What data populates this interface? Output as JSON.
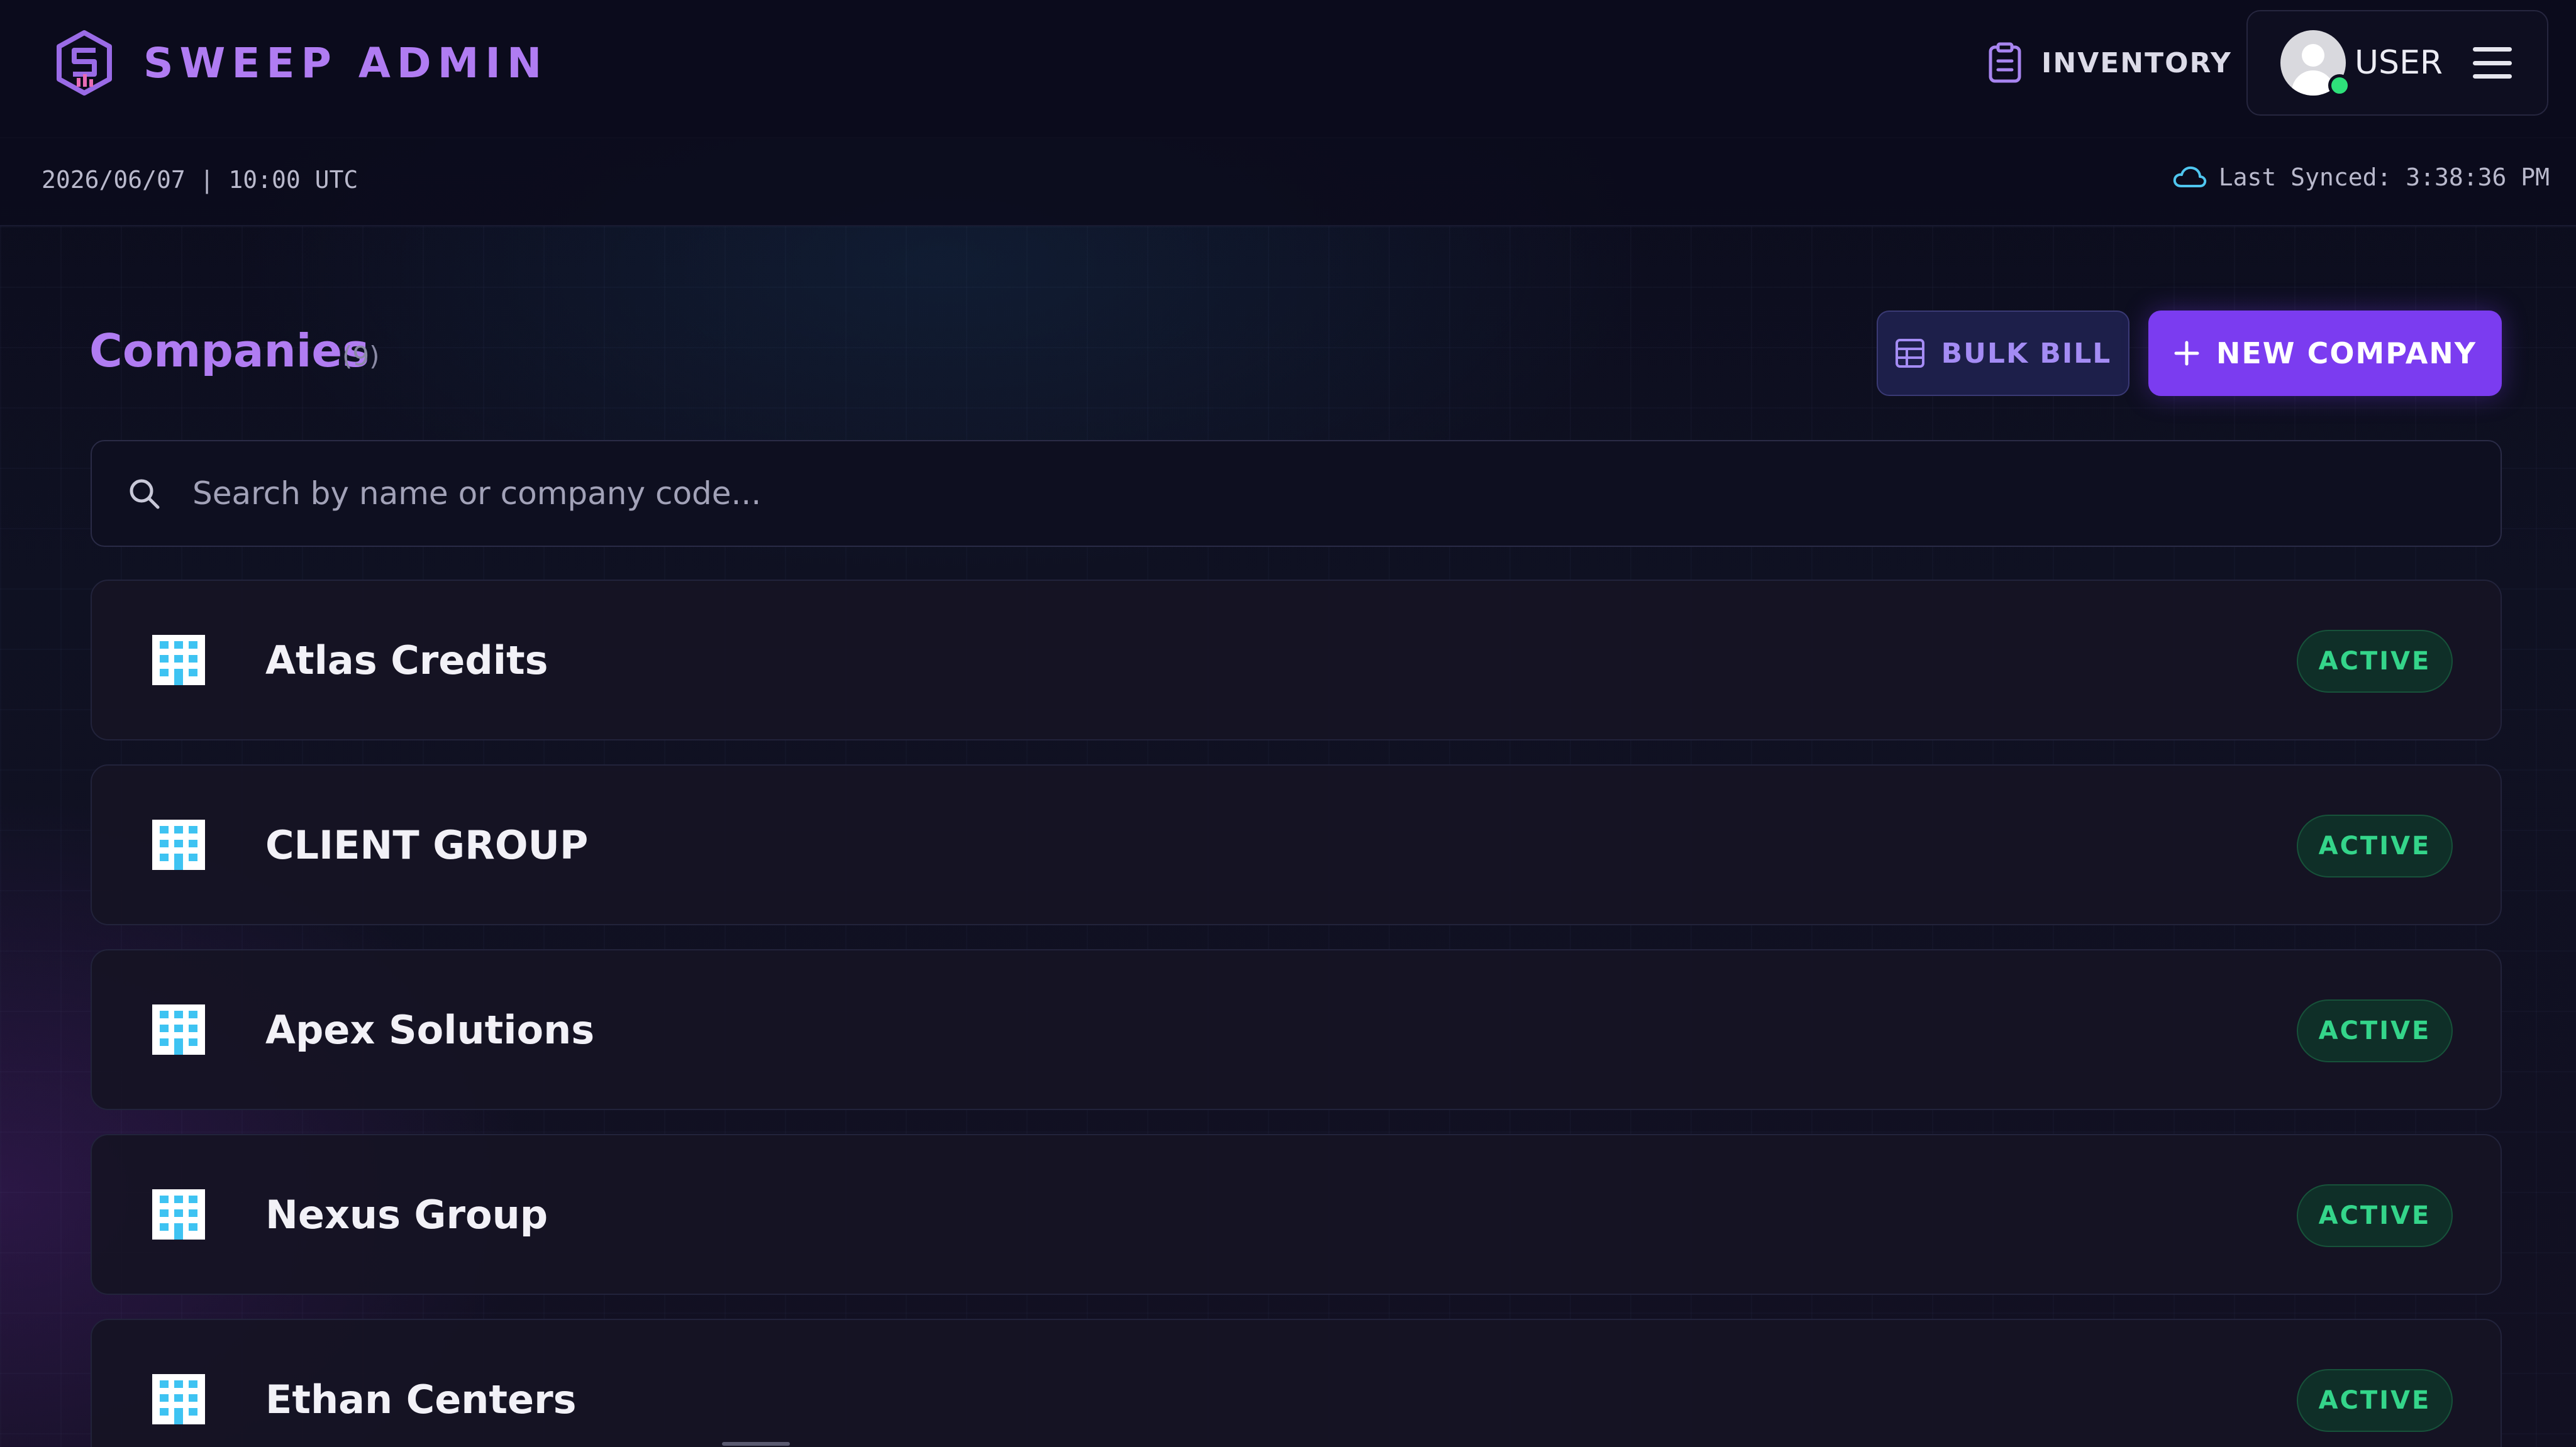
{
  "header": {
    "app_title": "SWEEP ADMIN",
    "inventory_label": "INVENTORY",
    "user_label": "USER",
    "brand_color": "#b07cf2"
  },
  "subbar": {
    "datetime": "2026/06/07 | 10:00 UTC",
    "last_synced": "Last Synced: 3:38:36 PM"
  },
  "main": {
    "title": "Companies",
    "count": "(9)",
    "bulk_bill_label": "BULK BILL",
    "new_company_label": "NEW COMPANY",
    "search_placeholder": "Search by name or company code...",
    "search_value": ""
  },
  "companies": [
    {
      "name": "Atlas Credits",
      "status": "ACTIVE"
    },
    {
      "name": "CLIENT GROUP",
      "status": "ACTIVE"
    },
    {
      "name": "Apex Solutions",
      "status": "ACTIVE"
    },
    {
      "name": "Nexus Group",
      "status": "ACTIVE"
    },
    {
      "name": "Ethan Centers",
      "status": "ACTIVE"
    }
  ],
  "colors": {
    "accent": "#7b3cf0",
    "status_active": "#34d58a",
    "icon_cyan": "#3ec3f2"
  },
  "icons": {
    "brand": "hexagon-logo-icon",
    "inventory": "clipboard-icon",
    "menu": "hamburger-menu-icon",
    "sync": "cloud-icon",
    "bulk_bill": "table-grid-icon",
    "new_company": "plus-icon",
    "search": "search-icon",
    "company": "building-icon"
  }
}
